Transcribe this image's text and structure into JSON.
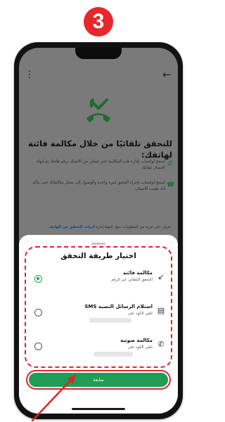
{
  "step_number": "3",
  "colors": {
    "accent_red": "#e8262b",
    "whatsapp_green": "#1f9d55",
    "link_blue": "#0a4a8a"
  },
  "verify_screen": {
    "heading": "للتحقق تلقائيًا من خلال مكالمة فائتة لهاتفك:",
    "paragraph_1": "اسمح لواتساب بإدارة هذه المكالمة حتى تتمكن من الاتصال برقم هاتفك ثم إنهاء الاتصال تلقائيًا.",
    "paragraph_2": "اسمح لواتساب بإجراء التحقق لمرة واحدة والوصول إلى سجل مكالماتك حتى يتأكد أنك تلقيت الاتصال.",
    "learn_more_prefix": "تعرف على مزيد من المعلومات حول كيفية إدارة",
    "learn_more_link": "أدوات التحقق من الهاتف"
  },
  "sheet": {
    "title": "اختيار طريقة التحقق",
    "options": [
      {
        "title": "مكالمة فائتة",
        "subtitle": "التحقق التلقائي عبر الرقم",
        "icon": "missed-call-icon",
        "selected": true
      },
      {
        "title": "استلام الرسائل النصية SMS",
        "subtitle": "تلقي الكود على",
        "icon": "message-icon",
        "selected": false
      },
      {
        "title": "مكالمة صوتية",
        "subtitle": "تلقي الكود على",
        "icon": "phone-icon",
        "selected": false
      }
    ],
    "continue_label": "متابعة"
  }
}
